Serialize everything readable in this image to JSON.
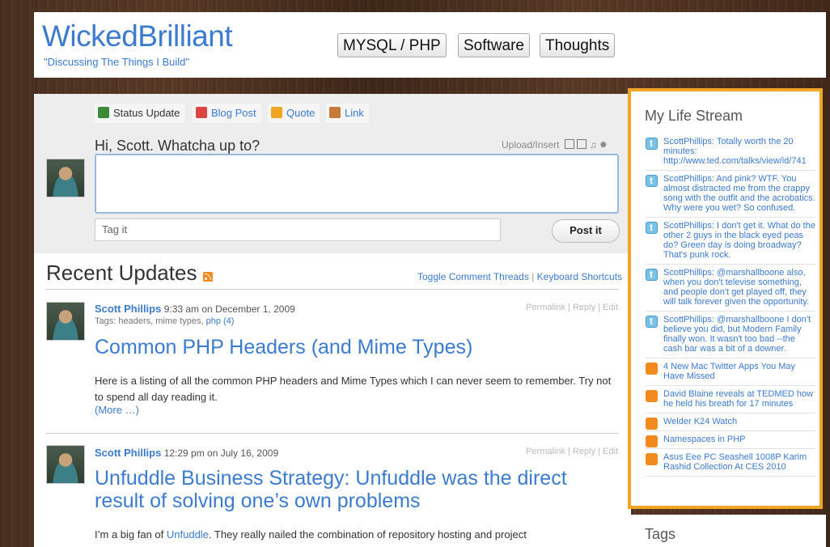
{
  "site": {
    "title": "WickedBrilliant",
    "tagline": "\"Discussing The Things I Build\""
  },
  "nav": [
    "MYSQL / PHP",
    "Software",
    "Thoughts"
  ],
  "composer": {
    "tabs": [
      {
        "label": "Status Update",
        "icon": "status-icon",
        "color": "#3a8a3a"
      },
      {
        "label": "Blog Post",
        "icon": "pushpin-icon",
        "color": "#d44"
      },
      {
        "label": "Quote",
        "icon": "quote-icon",
        "color": "#f0a623"
      },
      {
        "label": "Link",
        "icon": "link-icon",
        "color": "#c87a3a"
      }
    ],
    "greeting": "Hi, Scott. Whatcha up to?",
    "upload_label": "Upload/Insert",
    "tag_placeholder": "Tag it",
    "post_button": "Post it"
  },
  "recent": {
    "title": "Recent Updates",
    "toggle_link": "Toggle Comment Threads",
    "shortcuts_link": "Keyboard Shortcuts"
  },
  "posts": [
    {
      "author": "Scott Phillips",
      "time": "9:33 am on December 1, 2009",
      "tags_label": "Tags:",
      "tags": "headers, mime types,",
      "tag_link": "php (4)",
      "meta": "Permalink | Reply | Edit",
      "title": "Common PHP Headers (and Mime Types)",
      "body": "Here is a listing of all the common PHP headers and Mime Types which I can never seem to remember. Try not to spend all day reading it.",
      "more": "(More …)"
    },
    {
      "author": "Scott Phillips",
      "time": "12:29 pm on July 16, 2009",
      "meta": "Permalink | Reply | Edit",
      "title": "Unfuddle Business Strategy: Unfuddle was the direct result of solving one’s own problems",
      "body_pre": "I’m a big fan of ",
      "body_link": "Unfuddle",
      "body_post": ". They really nailed the combination of repository hosting and project"
    }
  ],
  "sidebar": {
    "title": "My Life Stream",
    "items": [
      {
        "type": "twitter",
        "text": "ScottPhillips: Totally worth the 20 minutes: http://www.ted.com/talks/view/id/741"
      },
      {
        "type": "twitter",
        "text": "ScottPhillips: And pink? WTF. You almost distracted me from the crappy song with the outfit and the acrobatics. Why were you wet? So confused."
      },
      {
        "type": "twitter",
        "text": "ScottPhillips: I don't get it. What do the other 2 guys in the black eyed peas do? Green day is doing broadway? That's punk rock."
      },
      {
        "type": "twitter",
        "text": "ScottPhillips: @marshallboone also, when you don't televise something, and people don't get played off, they will talk forever given the opportunity."
      },
      {
        "type": "twitter",
        "text": "ScottPhillips: @marshallboone I don't believe you did, but Modern Family finally won. It wasn't too bad --the cash bar was a bit of a downer."
      },
      {
        "type": "rss",
        "text": "4 New Mac Twitter Apps You May Have Missed"
      },
      {
        "type": "rss",
        "text": "David Blaine reveals at TEDMED how he held his breath for 17 minutes"
      },
      {
        "type": "rss",
        "text": "Welder K24 Watch"
      },
      {
        "type": "rss",
        "text": "Namespaces in PHP"
      },
      {
        "type": "rss",
        "text": "Asus Eee PC Seashell 1008P Karim Rashid Collection At CES 2010"
      }
    ],
    "tags_title": "Tags"
  },
  "colors": {
    "accent": "#3b7bd0",
    "highlight": "#f0a623"
  }
}
